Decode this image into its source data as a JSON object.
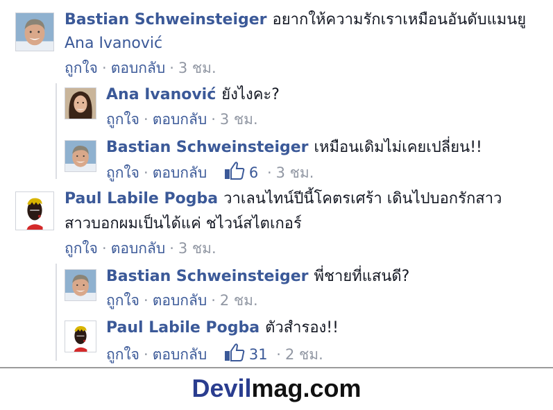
{
  "comments": [
    {
      "author": "Bastian Schweinsteiger",
      "text": "อยากให้ความรักเราเหมือนอันดับแมนยู",
      "text_line2": "Ana Ivanović",
      "like": "ถูกใจ",
      "reply": "ตอบกลับ",
      "likes": "",
      "time": "3 ชม.",
      "avatar_icon": "bastian-avatar"
    },
    {
      "author": "Ana Ivanović",
      "text": "ยังไงคะ?",
      "like": "ถูกใจ",
      "reply": "ตอบกลับ",
      "likes": "",
      "time": "3 ชม.",
      "avatar_icon": "ana-avatar"
    },
    {
      "author": "Bastian Schweinsteiger",
      "text": "เหมือนเดิมไม่เคยเปลี่ยน!!",
      "like": "ถูกใจ",
      "reply": "ตอบกลับ",
      "likes": "6",
      "time": "3 ชม.",
      "avatar_icon": "bastian-avatar"
    },
    {
      "author": "Paul Labile Pogba",
      "text": "วาเลนไทน์ปีนี้โคตรเศร้า เดินไปบอกรักสาว",
      "text_line2": "สาวบอกผมเป็นได้แค่ ชไวน์สไตเกอร์",
      "like": "ถูกใจ",
      "reply": "ตอบกลับ",
      "likes": "",
      "time": "3 ชม.",
      "avatar_icon": "pogba-avatar"
    },
    {
      "author": "Bastian Schweinsteiger",
      "text": "พี่ชายที่แสนดี?",
      "like": "ถูกใจ",
      "reply": "ตอบกลับ",
      "likes": "",
      "time": "2 ชม.",
      "avatar_icon": "bastian-avatar"
    },
    {
      "author": "Paul Labile Pogba",
      "text": "ตัวสำรอง!!",
      "like": "ถูกใจ",
      "reply": "ตอบกลับ",
      "likes": "31",
      "time": "2 ชม.",
      "avatar_icon": "pogba-avatar"
    }
  ],
  "footer": {
    "brand_part1": "Devil",
    "brand_part2": "mag.com"
  },
  "colors": {
    "link": "#3b5998",
    "meta": "#9197a3",
    "text": "#141823",
    "brand_blue": "#2a3d8f"
  },
  "icons": {
    "like_thumb": "thumbs-up-icon"
  }
}
